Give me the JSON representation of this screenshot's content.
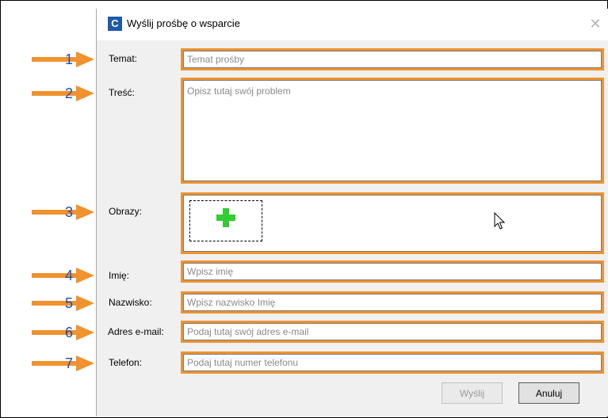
{
  "dialog": {
    "title": "Wyślij prośbę o wsparcie",
    "app_icon": "C",
    "close_glyph": "✕"
  },
  "fields": [
    {
      "key": "subject",
      "label": "Temat:",
      "placeholder": "Temat prośby"
    },
    {
      "key": "content",
      "label": "Treść:",
      "placeholder": "Opisz tutaj swój problem"
    },
    {
      "key": "images",
      "label": "Obrazy:"
    },
    {
      "key": "first_name",
      "label": "Imię:",
      "placeholder": "Wpisz imię"
    },
    {
      "key": "last_name",
      "label": "Nazwisko:",
      "placeholder": "Wpisz nazwisko Imię"
    },
    {
      "key": "email",
      "label": "Adres e-mail:",
      "placeholder": "Podaj tutaj swój adres e-mail"
    },
    {
      "key": "phone",
      "label": "Telefon:",
      "placeholder": "Podaj tutaj numer telefonu"
    }
  ],
  "buttons": {
    "send": "Wyślij",
    "cancel": "Anuluj"
  },
  "callouts": [
    "1",
    "2",
    "3",
    "4",
    "5",
    "6",
    "7"
  ],
  "colors": {
    "highlight": "#f0922e",
    "callout_number": "#1e4fb8",
    "add_icon": "#33cc33",
    "app_icon_bg": "#1e5aa8"
  },
  "icons": {
    "add_image": "plus-icon",
    "cursor": "mouse-pointer-icon",
    "close": "close-icon"
  }
}
